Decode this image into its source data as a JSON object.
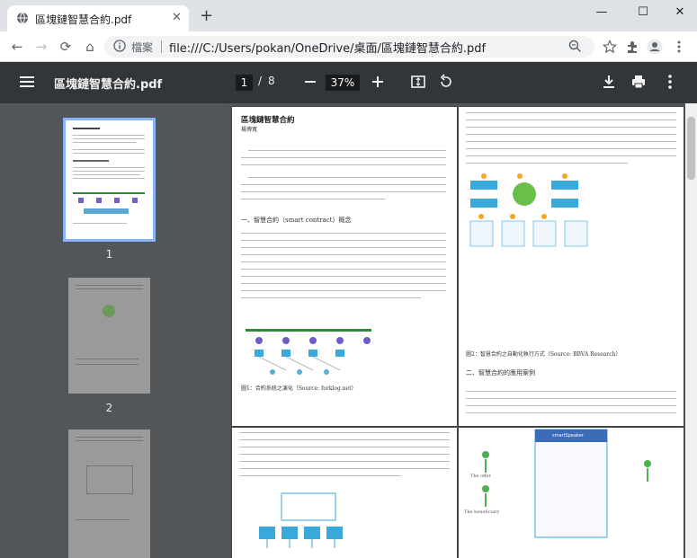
{
  "tab": {
    "title": "區塊鏈智慧合約.pdf",
    "close": "✕"
  },
  "newtab": "+",
  "window": {
    "minimize": "—",
    "maximize": "☐",
    "close": "✕"
  },
  "nav": {
    "back": "←",
    "forward": "→",
    "reload": "⟳",
    "home": "⌂"
  },
  "omnibox": {
    "label": "檔案",
    "url": "file:///C:/Users/pokan/OneDrive/桌面/區塊鏈智慧合約.pdf"
  },
  "pdf": {
    "title": "區塊鏈智慧合約.pdf",
    "current_page": "1",
    "page_sep": "/",
    "total_pages": "8",
    "zoom": "37%"
  },
  "thumbnails": [
    {
      "num": "1"
    },
    {
      "num": "2"
    }
  ],
  "page1": {
    "title": "區塊鏈智慧合約",
    "author": "楊博寬",
    "section": "一、智慧合約（smart contract）概念",
    "figure_caption": "圖1：合約系統之演化（Source: forklog.net）"
  },
  "page2": {
    "figure_caption": "圖2：智慧合約之自動化執行方式（Source: BBVA Research）",
    "section": "二、智慧合約的應用案例"
  },
  "page4": {
    "label_box": "smartSpeaker",
    "label1": "The offer",
    "label2": "The beneficiary"
  }
}
